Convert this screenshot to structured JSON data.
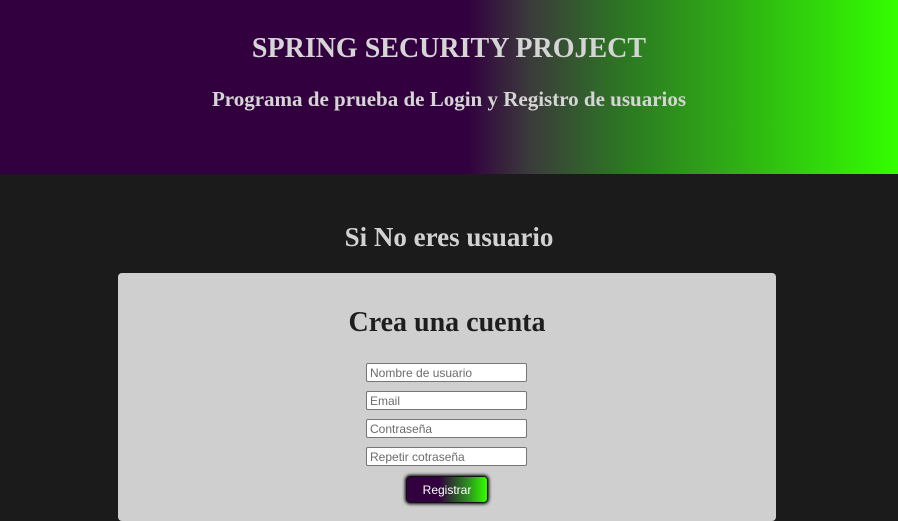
{
  "header": {
    "title": "SPRING SECURITY PROJECT",
    "subtitle": "Programa de prueba de Login y Registro de usuarios"
  },
  "main": {
    "heading": "Si No eres usuario"
  },
  "register_form": {
    "title": "Crea una cuenta",
    "fields": {
      "username": {
        "placeholder": "Nombre de usuario",
        "value": ""
      },
      "email": {
        "placeholder": "Email",
        "value": ""
      },
      "password": {
        "placeholder": "Contraseña",
        "value": ""
      },
      "password_repeat": {
        "placeholder": "Repetir cotraseña",
        "value": ""
      }
    },
    "submit_label": "Registrar"
  },
  "colors": {
    "page_background": "#1b1b1b",
    "header_gradient_start": "#32003f",
    "header_gradient_end": "#33ff00",
    "card_background": "#cfcfcf",
    "heading_text": "#d5d5d5"
  }
}
